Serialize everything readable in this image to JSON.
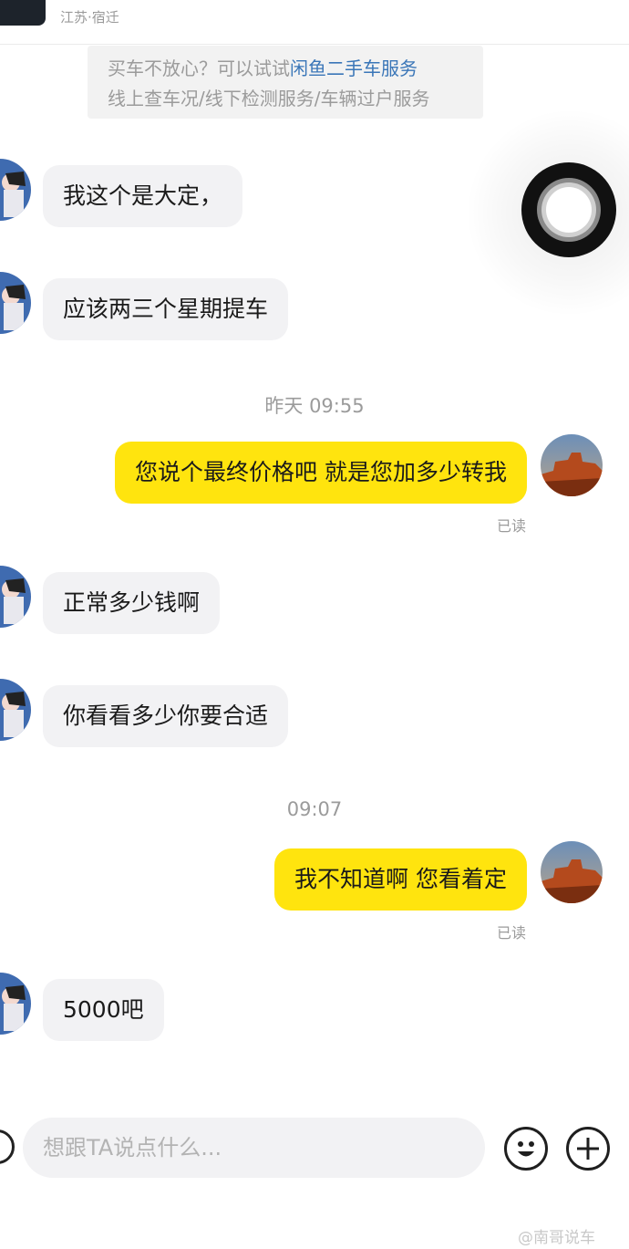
{
  "header": {
    "location": "江苏·宿迁"
  },
  "notice": {
    "line1_prefix": "买车不放心？可以试试",
    "line1_link": "闲鱼二手车服务",
    "line2": "线上查车况/线下检测服务/车辆过户服务"
  },
  "messages": [
    {
      "from": "other",
      "text": "我这个是大定，"
    },
    {
      "from": "other",
      "text": "应该两三个星期提车"
    },
    {
      "from": "system",
      "text": "昨天 09:55"
    },
    {
      "from": "me",
      "text": "您说个最终价格吧 就是您加多少转我",
      "status": "已读"
    },
    {
      "from": "other",
      "text": "正常多少钱啊"
    },
    {
      "from": "other",
      "text": "你看看多少你要合适"
    },
    {
      "from": "system",
      "text": "09:07"
    },
    {
      "from": "me",
      "text": "我不知道啊 您看着定",
      "status": "已读"
    },
    {
      "from": "other",
      "text": "5000吧"
    }
  ],
  "composer": {
    "placeholder": "想跟TA说点什么...",
    "value": ""
  },
  "icons": {
    "emoji": "smile-face-icon",
    "plus": "plus-icon",
    "assistive_touch": "assistive-touch-icon",
    "voice": "voice-icon"
  },
  "colors": {
    "outgoing_bubble": "#ffe40e",
    "incoming_bubble": "#f2f2f4",
    "notice_link": "#3a76b8"
  },
  "watermark": "@南哥说车"
}
